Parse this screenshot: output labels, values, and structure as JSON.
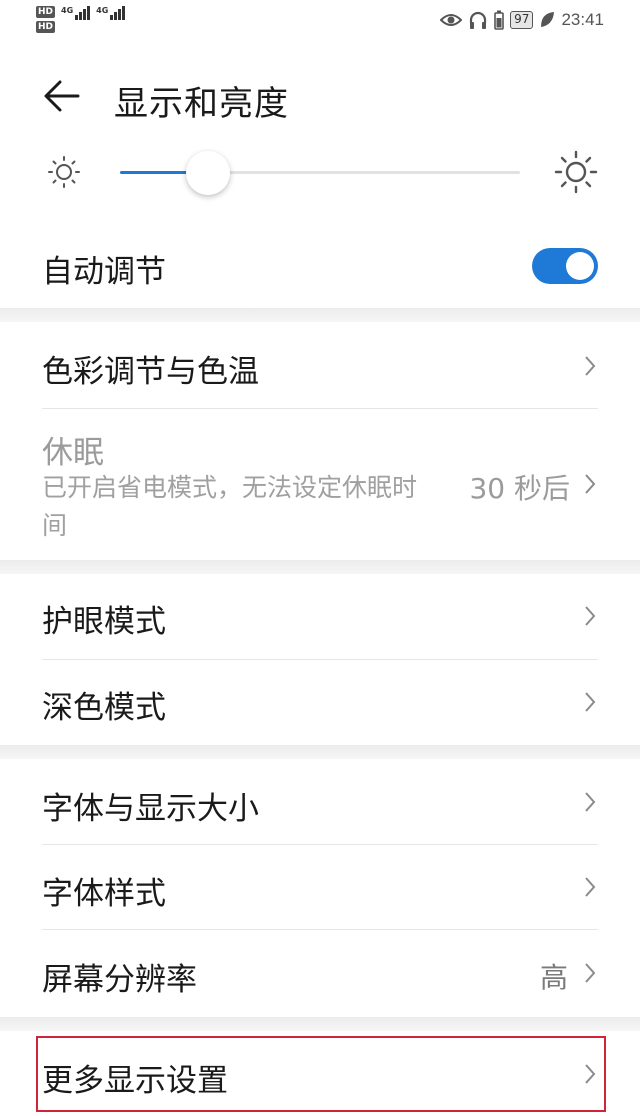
{
  "status_bar": {
    "sim1": "HD",
    "sim2": "HD",
    "network1": "4G",
    "network2": "4G",
    "battery": "97",
    "time": "23:41"
  },
  "header": {
    "title": "显示和亮度",
    "back_icon": "arrow-left-icon"
  },
  "brightness": {
    "level": 0.22,
    "accent": "#1e7ad6"
  },
  "auto_adjust": {
    "label": "自动调节",
    "enabled": true
  },
  "settings": {
    "color": {
      "label": "色彩调节与色温"
    },
    "sleep": {
      "label": "休眠",
      "description": "已开启省电模式，无法设定休眠时间",
      "value": "30 秒后"
    },
    "eye_comfort": {
      "label": "护眼模式"
    },
    "dark_mode": {
      "label": "深色模式"
    },
    "font_size": {
      "label": "字体与显示大小"
    },
    "font_style": {
      "label": "字体样式"
    },
    "resolution": {
      "label": "屏幕分辨率",
      "value": "高"
    },
    "more": {
      "label": "更多显示设置"
    }
  },
  "highlight_color": "#d0243a"
}
